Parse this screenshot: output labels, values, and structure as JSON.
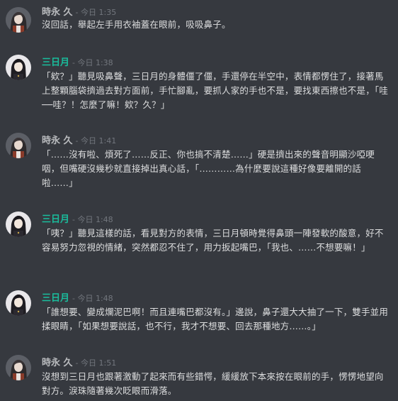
{
  "colors": {
    "background": "#36393f",
    "text": "#dcddde",
    "timestamp": "#72767d",
    "user_tokinaga": "#b9bbbe",
    "user_mikazuki": "#1abc9c"
  },
  "messages": [
    {
      "author": "時永 久",
      "timestamp": "今日 1:35",
      "text": "沒回話，舉起左手用衣袖蓋在眼前，吸吸鼻子。"
    },
    {
      "author": "三日月",
      "timestamp": "今日 1:38",
      "text": "「欸？」聽見吸鼻聲，三日月的身體僵了僵，手還停在半空中，表情都愣住了，接著馬上整顆腦袋擠過去對方面前，手忙腳亂，要抓人家的手也不是，要找東西擦也不是，「哇──哇？！怎麼了嘛！欸？久？」"
    },
    {
      "author": "時永 久",
      "timestamp": "今日 1:41",
      "text": "「……沒有啦、煩死了……反正、你也搞不清楚……」硬是擠出來的聲音明顯沙啞哽咽，但嘴硬沒幾秒就直接掉出真心話，「…………為什麼要說這種好像要離開的話啦……」"
    },
    {
      "author": "三日月",
      "timestamp": "今日 1:48",
      "text": "「咦？」聽見這樣的話，看見對方的表情，三日月頓時覺得鼻頭一陣發軟的酸意，好不容易努力忽視的情緒，突然都忍不住了，用力扳起嘴巴，「我也、……不想要嘛！」"
    },
    {
      "author": "三日月",
      "timestamp": "今日 1:48",
      "text": "「誰想要、變成爛泥巴啊！而且連嘴巴都沒有。」邊說，鼻子還大大抽了一下，雙手並用揉眼睛，「如果想要說話，也不行，我才不想要、回去那種地方……。」"
    },
    {
      "author": "時永 久",
      "timestamp": "今日 1:51",
      "text": "沒想到三日月也跟著激動了起來而有些錯愕，緩緩放下本來按在眼前的手，愣愣地望向對方。淚珠隨著幾次眨眼而滑落。"
    }
  ]
}
